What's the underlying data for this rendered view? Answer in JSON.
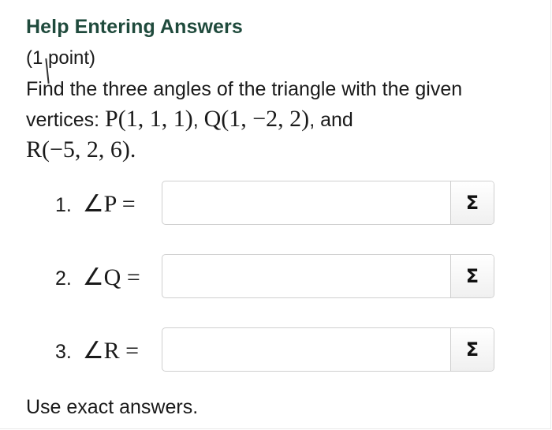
{
  "header": {
    "title": "Help Entering Answers"
  },
  "question": {
    "points": "(1 point)",
    "text_prefix": "Find the three angles of the triangle with the given vertices: ",
    "P": "P(1, 1, 1)",
    "sep1": ", ",
    "Q": "Q(1, −2, 2)",
    "sep2": ", and",
    "R": "R(−5, 2, 6)",
    "end": "."
  },
  "answers": [
    {
      "number": "1.",
      "label": "∠P =",
      "value": "",
      "button": "Σ"
    },
    {
      "number": "2.",
      "label": "∠Q =",
      "value": "",
      "button": "Σ"
    },
    {
      "number": "3.",
      "label": "∠R =",
      "value": "",
      "button": "Σ"
    }
  ],
  "footer": {
    "note": "Use exact answers."
  }
}
